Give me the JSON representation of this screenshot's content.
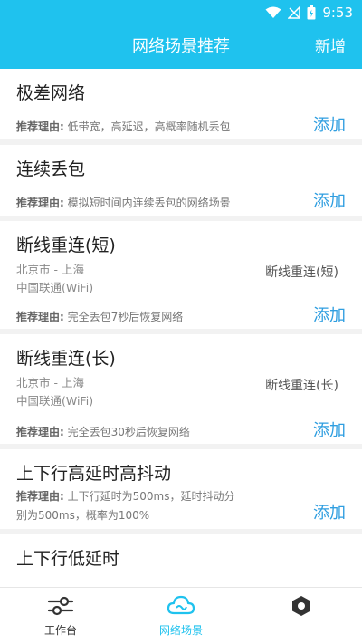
{
  "status": {
    "time": "9:53"
  },
  "header": {
    "title": "网络场景推荐",
    "action_label": "新增"
  },
  "reason_label": "推荐理由:",
  "add_label": "添加",
  "cards": [
    {
      "title": "极差网络",
      "reason": "低带宽，高延迟，高概率随机丢包"
    },
    {
      "title": "连续丢包",
      "reason": "模拟短时间内连续丢包的网络场景"
    },
    {
      "title": "断线重连(短)",
      "location": "北京市 - 上海",
      "carrier": "中国联通(WiFi)",
      "tag": "断线重连(短)",
      "reason": "完全丢包7秒后恢复网络"
    },
    {
      "title": "断线重连(长)",
      "location": "北京市 - 上海",
      "carrier": "中国联通(WiFi)",
      "tag": "断线重连(长)",
      "reason": "完全丢包30秒后恢复网络"
    },
    {
      "title": "上下行高延时高抖动",
      "reason_line1": "上下行延时为500ms，延时抖动分",
      "reason_line2": "别为500ms，概率为100%"
    },
    {
      "title": "上下行低延时"
    }
  ],
  "tabs": [
    {
      "label": "工作台",
      "icon": "sliders-icon"
    },
    {
      "label": "网络场景",
      "icon": "cloud-icon"
    },
    {
      "label": "",
      "icon": "box-icon"
    }
  ],
  "colors": {
    "accent": "#1fc2ee",
    "link": "#2f9ee0"
  }
}
